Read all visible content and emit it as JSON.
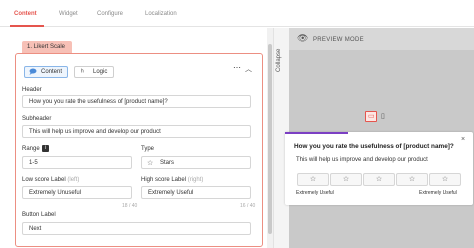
{
  "tabs": [
    {
      "label": "Content",
      "active": true
    },
    {
      "label": "Widget",
      "active": false
    },
    {
      "label": "Configure",
      "active": false
    },
    {
      "label": "Localization",
      "active": false
    }
  ],
  "step_tab": "1. Likert Scale",
  "editor": {
    "content_button": "Content",
    "logic_button": "Logic",
    "more_icon": "ellipsis-icon",
    "collapse_icon": "chevron-up-icon",
    "header_label": "Header",
    "header_value": "How you you rate the usefulness of [product name]?",
    "subheader_label": "Subheader",
    "subheader_value": "This will help us improve and develop our product",
    "range_label": "Range",
    "range_value": "1-5",
    "type_label": "Type",
    "type_value": "Stars",
    "low_label": "Low score Label",
    "low_hint": "(left)",
    "low_value": "Extremely Unuseful",
    "high_label": "High score Label",
    "high_hint": "(right)",
    "high_value": "Extremely Useful",
    "high_counter": "16 / 40",
    "low_counter": "18 / 40",
    "button_label": "Button Label",
    "button_value": "Next"
  },
  "collapse_label": "Collapse",
  "preview": {
    "title": "PREVIEW MODE",
    "question": "How you you rate the usefulness of [product name]?",
    "subheader": "This will help us improve and develop our product",
    "stars": [
      "☆",
      "☆",
      "☆",
      "☆",
      "☆"
    ],
    "low_label": "Extremely Useful",
    "high_label": "Extremely Useful",
    "close": "×",
    "progress": 0.33
  },
  "colors": {
    "accent": "#e5554e",
    "progress": "#7b3fc3"
  }
}
